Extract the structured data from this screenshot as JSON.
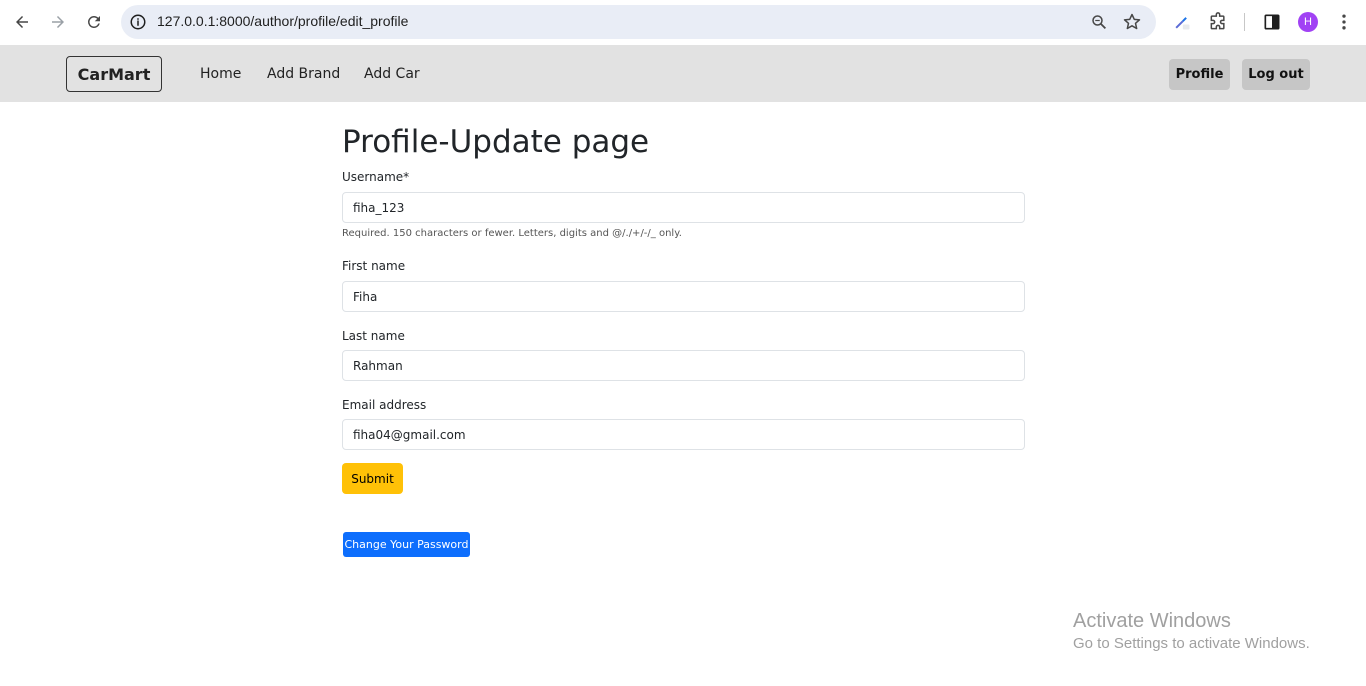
{
  "browser": {
    "url": "127.0.0.1:8000/author/profile/edit_profile",
    "avatar_letter": "H",
    "icons": [
      "back-arrow-icon",
      "forward-arrow-icon",
      "reload-icon",
      "info-icon",
      "zoom-icon",
      "star-icon",
      "extension-icon",
      "puzzle-icon",
      "sidepanel-icon",
      "menu-dots-icon"
    ]
  },
  "navbar": {
    "brand": "CarMart",
    "links": [
      "Home",
      "Add Brand",
      "Add Car"
    ],
    "profile_label": "Profile",
    "logout_label": "Log out"
  },
  "form": {
    "title": "Profile-Update page",
    "username_label": "Username*",
    "username_value": "fiha_123",
    "username_help": "Required. 150 characters or fewer. Letters, digits and @/./+/-/_ only.",
    "first_name_label": "First name",
    "first_name_value": "Fiha",
    "last_name_label": "Last name",
    "last_name_value": "Rahman",
    "email_label": "Email address",
    "email_value": "fiha04@gmail.com",
    "submit_label": "Submit",
    "change_password_label": "Change Your Password"
  },
  "watermark": {
    "line1": "Activate Windows",
    "line2": "Go to Settings to activate Windows."
  },
  "colors": {
    "submit": "#ffc107",
    "change_password": "#0d6efd",
    "navbar": "#e2e2e2",
    "avatar": "#a142f4"
  }
}
